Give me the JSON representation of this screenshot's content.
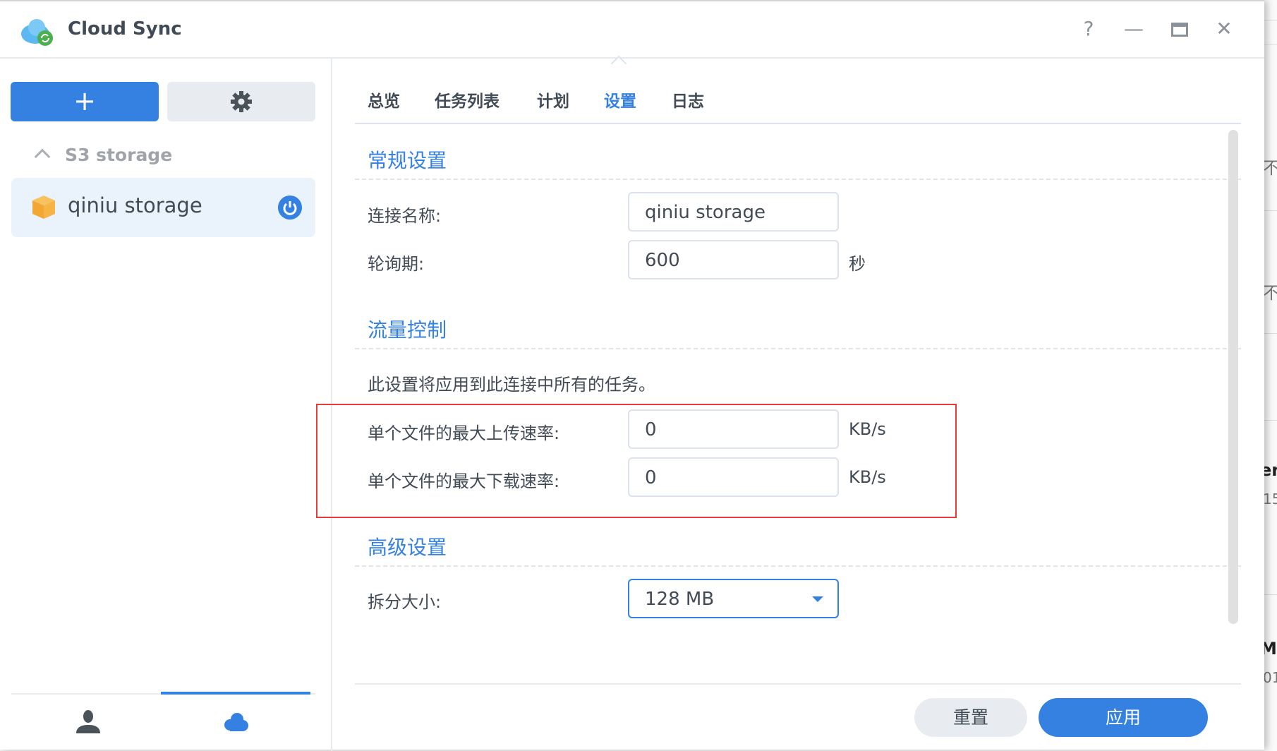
{
  "app": {
    "title": "Cloud Sync"
  },
  "window_controls": {
    "help": "?",
    "minimize": "—",
    "maximize": "□",
    "close": "✕"
  },
  "sidebar": {
    "add_label": "+",
    "group": {
      "label": "S3 storage"
    },
    "items": [
      {
        "label": "qiniu storage"
      }
    ]
  },
  "tabs": [
    {
      "label": "总览"
    },
    {
      "label": "任务列表"
    },
    {
      "label": "计划"
    },
    {
      "label": "设置",
      "active": true
    },
    {
      "label": "日志"
    }
  ],
  "general": {
    "title": "常规设置",
    "connection_name_label": "连接名称:",
    "connection_name_value": "qiniu storage",
    "polling_label": "轮询期:",
    "polling_value": "600",
    "polling_unit": "秒"
  },
  "traffic": {
    "title": "流量控制",
    "note": "此设置将应用到此连接中所有的任务。",
    "upload_label": "单个文件的最大上传速率:",
    "upload_value": "0",
    "upload_unit": "KB/s",
    "download_label": "单个文件的最大下载速率:",
    "download_value": "0",
    "download_unit": "KB/s"
  },
  "advanced": {
    "title": "高级设置",
    "split_label": "拆分大小:",
    "split_value": "128 MB"
  },
  "footer": {
    "reset": "重置",
    "apply": "应用"
  },
  "background_fragments": [
    "不",
    "不",
    "er",
    "15",
    "Ma",
    "01"
  ],
  "colors": {
    "accent": "#3481e2",
    "highlight": "#e53b3b"
  }
}
